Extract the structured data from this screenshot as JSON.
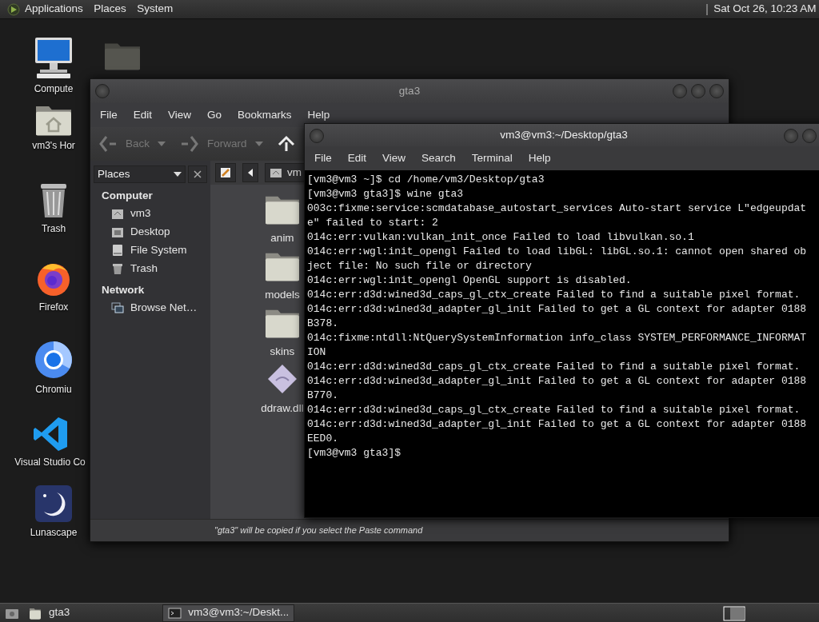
{
  "top_panel": {
    "menus": [
      "Applications",
      "Places",
      "System"
    ],
    "clock": "Sat Oct 26, 10:23 AM"
  },
  "desktop_icons": [
    {
      "label": "Compute",
      "kind": "computer"
    },
    {
      "label": "vm3's Hor",
      "kind": "home"
    },
    {
      "label": "Trash",
      "kind": "trash"
    },
    {
      "label": "Firefox",
      "kind": "firefox"
    },
    {
      "label": "Chromiu",
      "kind": "chromium"
    },
    {
      "label": "Visual Studio Co",
      "kind": "vscode"
    },
    {
      "label": "Lunascape",
      "kind": "moon"
    },
    {
      "kind": "folder"
    }
  ],
  "file_manager": {
    "title": "gta3",
    "menu": [
      "File",
      "Edit",
      "View",
      "Go",
      "Bookmarks",
      "Help"
    ],
    "toolbar": [
      {
        "label": "Back",
        "kind": "back",
        "disabled": true
      },
      {
        "label": "Forward",
        "kind": "forward",
        "disabled": true
      },
      {
        "kind": "up",
        "disabled": false
      }
    ],
    "sidebar": {
      "selector": "Places",
      "sections": [
        {
          "heading": "Computer",
          "items": [
            {
              "label": "vm3",
              "kind": "home"
            },
            {
              "label": "Desktop",
              "kind": "desktop"
            },
            {
              "label": "File System",
              "kind": "drive"
            },
            {
              "label": "Trash",
              "kind": "trash"
            }
          ]
        },
        {
          "heading": "Network",
          "items": [
            {
              "label": "Browse Net…",
              "kind": "network"
            }
          ]
        }
      ]
    },
    "location": "vm",
    "files": [
      {
        "name": "anim",
        "kind": "folder"
      },
      {
        "name": "models",
        "kind": "folder"
      },
      {
        "name": "skins",
        "kind": "folder"
      },
      {
        "name": "ddraw.dll",
        "kind": "dll"
      }
    ],
    "status": "\"gta3\" will be copied if you select the Paste command"
  },
  "terminal": {
    "title": "vm3@vm3:~/Desktop/gta3",
    "menu": [
      "File",
      "Edit",
      "View",
      "Search",
      "Terminal",
      "Help"
    ],
    "lines": [
      "[vm3@vm3 ~]$ cd /home/vm3/Desktop/gta3",
      "[vm3@vm3 gta3]$ wine gta3",
      "003c:fixme:service:scmdatabase_autostart_services Auto-start service L\"edgeupdat",
      "e\" failed to start: 2",
      "014c:err:vulkan:vulkan_init_once Failed to load libvulkan.so.1",
      "014c:err:wgl:init_opengl Failed to load libGL: libGL.so.1: cannot open shared ob",
      "ject file: No such file or directory",
      "014c:err:wgl:init_opengl OpenGL support is disabled.",
      "014c:err:d3d:wined3d_caps_gl_ctx_create Failed to find a suitable pixel format.",
      "014c:err:d3d:wined3d_adapter_gl_init Failed to get a GL context for adapter 0188",
      "B378.",
      "014c:fixme:ntdll:NtQuerySystemInformation info_class SYSTEM_PERFORMANCE_INFORMAT",
      "ION",
      "014c:err:d3d:wined3d_caps_gl_ctx_create Failed to find a suitable pixel format.",
      "014c:err:d3d:wined3d_adapter_gl_init Failed to get a GL context for adapter 0188",
      "B770.",
      "014c:err:d3d:wined3d_caps_gl_ctx_create Failed to find a suitable pixel format.",
      "014c:err:d3d:wined3d_adapter_gl_init Failed to get a GL context for adapter 0188",
      "EED0.",
      "[vm3@vm3 gta3]$"
    ]
  },
  "taskbar": {
    "tasks": [
      {
        "label": "gta3",
        "kind": "folder",
        "selected": false
      },
      {
        "label": "vm3@vm3:~/Deskt...",
        "kind": "terminal",
        "selected": true
      }
    ]
  }
}
